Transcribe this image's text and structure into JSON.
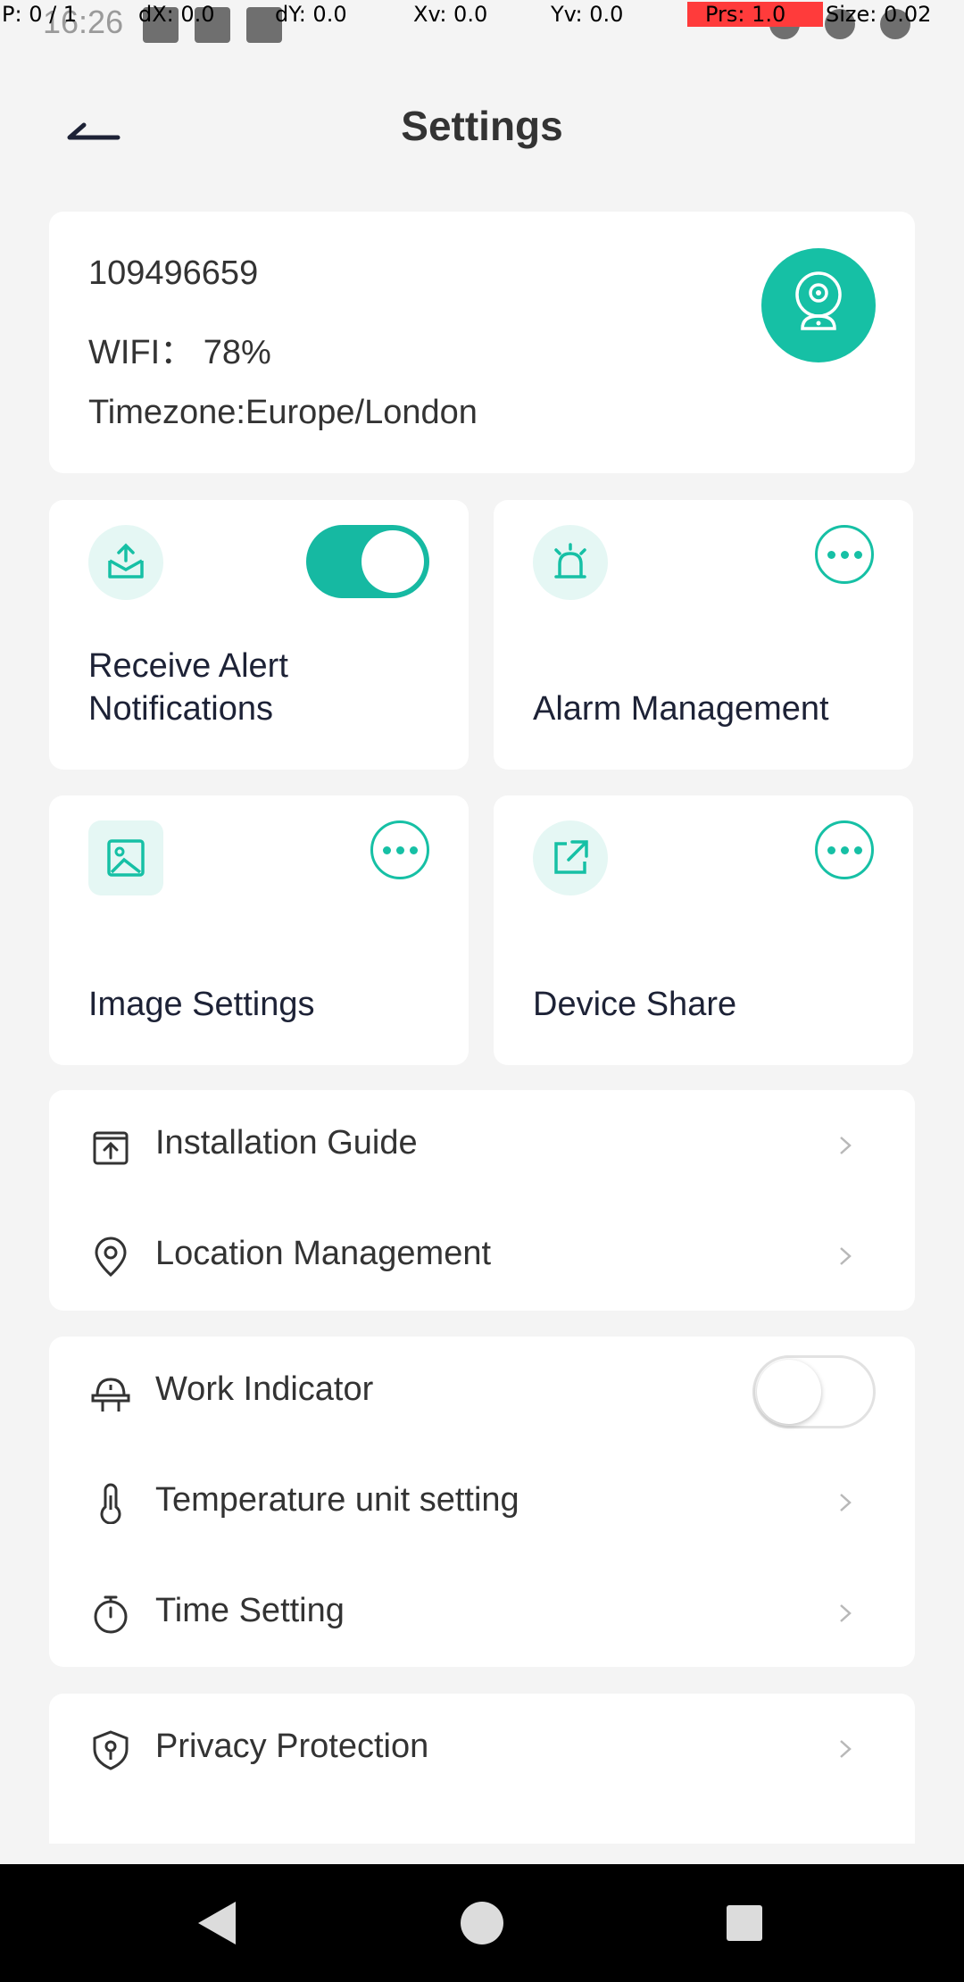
{
  "status_bar": {
    "time": "16:26"
  },
  "debug_overlay": {
    "p": "P: 0 / 1",
    "dx": "dX: 0.0",
    "dy": "dY: 0.0",
    "xv": "Xv: 0.0",
    "yv": "Yv: 0.0",
    "prs": "Prs: 1.0",
    "size": "Size: 0.02",
    "prs_color": "#ff3b3b"
  },
  "header": {
    "title": "Settings",
    "back_icon": "back-arrow-icon"
  },
  "device_info": {
    "id": "109496659",
    "wifi": "WIFI：  78%",
    "timezone": "Timezone:Europe/London",
    "avatar_icon": "camera-icon"
  },
  "tiles": [
    {
      "label": "Receive Alert Notifications",
      "icon": "upload-tray-icon",
      "control": "toggle",
      "toggle_on": true
    },
    {
      "label": "Alarm Management",
      "icon": "alarm-siren-icon",
      "control": "more"
    },
    {
      "label": "Image Settings",
      "icon": "image-icon",
      "control": "more"
    },
    {
      "label": "Device Share",
      "icon": "share-external-icon",
      "control": "more"
    }
  ],
  "group1": [
    {
      "label": "Installation Guide",
      "icon": "box-upload-icon"
    },
    {
      "label": "Location Management",
      "icon": "location-pin-icon"
    }
  ],
  "group2": [
    {
      "label": "Work Indicator",
      "icon": "indicator-light-icon",
      "control": "toggle",
      "toggle_on": false
    },
    {
      "label": "Temperature unit setting",
      "icon": "thermometer-icon"
    },
    {
      "label": "Time Setting",
      "icon": "stopwatch-icon"
    }
  ],
  "group3": [
    {
      "label": "Privacy Protection",
      "icon": "shield-pin-icon"
    }
  ],
  "colors": {
    "accent": "#16c0a5",
    "background": "#f4f4f4",
    "card": "#ffffff"
  }
}
